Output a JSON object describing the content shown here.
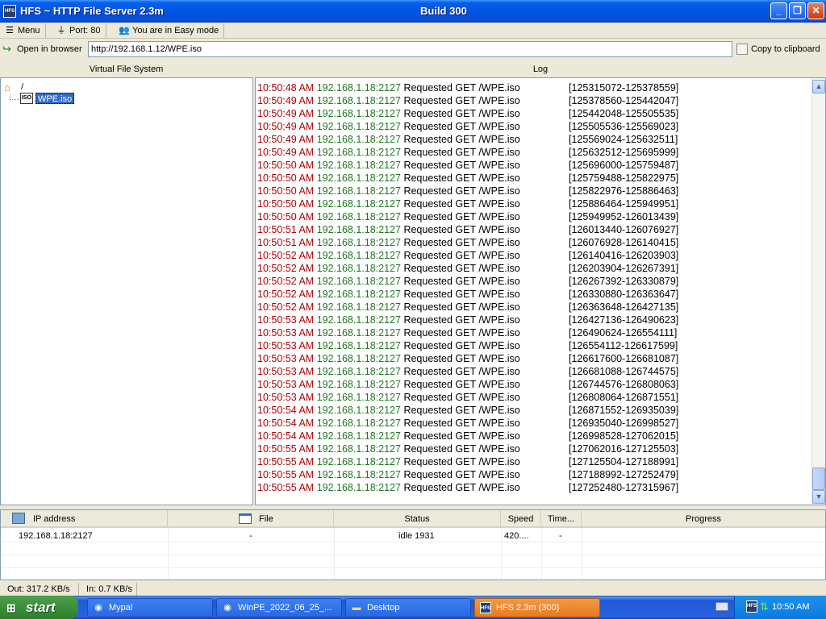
{
  "window": {
    "title": "HFS ~ HTTP File Server 2.3m",
    "build": "Build 300",
    "app_icon_text": "HFS"
  },
  "toolbar": {
    "menu_label": "Menu",
    "port_label": "Port: 80",
    "mode_label": "You are in Easy mode"
  },
  "address": {
    "open_label": "Open in browser",
    "url": "http://192.168.1.12/WPE.iso",
    "copy_label": "Copy to clipboard"
  },
  "vfs": {
    "header": "Virtual File System",
    "root_label": "/",
    "file_label": "WPE.iso",
    "file_icon_text": "ISO"
  },
  "log": {
    "header": "Log",
    "entries": [
      {
        "time": "10:50:48 AM",
        "ip": "192.168.1.18:2127",
        "msg": "Requested GET /WPE.iso",
        "range": "[125315072-125378559]"
      },
      {
        "time": "10:50:49 AM",
        "ip": "192.168.1.18:2127",
        "msg": "Requested GET /WPE.iso",
        "range": "[125378560-125442047]"
      },
      {
        "time": "10:50:49 AM",
        "ip": "192.168.1.18:2127",
        "msg": "Requested GET /WPE.iso",
        "range": "[125442048-125505535]"
      },
      {
        "time": "10:50:49 AM",
        "ip": "192.168.1.18:2127",
        "msg": "Requested GET /WPE.iso",
        "range": "[125505536-125569023]"
      },
      {
        "time": "10:50:49 AM",
        "ip": "192.168.1.18:2127",
        "msg": "Requested GET /WPE.iso",
        "range": "[125569024-125632511]"
      },
      {
        "time": "10:50:49 AM",
        "ip": "192.168.1.18:2127",
        "msg": "Requested GET /WPE.iso",
        "range": "[125632512-125695999]"
      },
      {
        "time": "10:50:50 AM",
        "ip": "192.168.1.18:2127",
        "msg": "Requested GET /WPE.iso",
        "range": "[125696000-125759487]"
      },
      {
        "time": "10:50:50 AM",
        "ip": "192.168.1.18:2127",
        "msg": "Requested GET /WPE.iso",
        "range": "[125759488-125822975]"
      },
      {
        "time": "10:50:50 AM",
        "ip": "192.168.1.18:2127",
        "msg": "Requested GET /WPE.iso",
        "range": "[125822976-125886463]"
      },
      {
        "time": "10:50:50 AM",
        "ip": "192.168.1.18:2127",
        "msg": "Requested GET /WPE.iso",
        "range": "[125886464-125949951]"
      },
      {
        "time": "10:50:50 AM",
        "ip": "192.168.1.18:2127",
        "msg": "Requested GET /WPE.iso",
        "range": "[125949952-126013439]"
      },
      {
        "time": "10:50:51 AM",
        "ip": "192.168.1.18:2127",
        "msg": "Requested GET /WPE.iso",
        "range": "[126013440-126076927]"
      },
      {
        "time": "10:50:51 AM",
        "ip": "192.168.1.18:2127",
        "msg": "Requested GET /WPE.iso",
        "range": "[126076928-126140415]"
      },
      {
        "time": "10:50:52 AM",
        "ip": "192.168.1.18:2127",
        "msg": "Requested GET /WPE.iso",
        "range": "[126140416-126203903]"
      },
      {
        "time": "10:50:52 AM",
        "ip": "192.168.1.18:2127",
        "msg": "Requested GET /WPE.iso",
        "range": "[126203904-126267391]"
      },
      {
        "time": "10:50:52 AM",
        "ip": "192.168.1.18:2127",
        "msg": "Requested GET /WPE.iso",
        "range": "[126267392-126330879]"
      },
      {
        "time": "10:50:52 AM",
        "ip": "192.168.1.18:2127",
        "msg": "Requested GET /WPE.iso",
        "range": "[126330880-126363647]"
      },
      {
        "time": "10:50:52 AM",
        "ip": "192.168.1.18:2127",
        "msg": "Requested GET /WPE.iso",
        "range": "[126363648-126427135]"
      },
      {
        "time": "10:50:53 AM",
        "ip": "192.168.1.18:2127",
        "msg": "Requested GET /WPE.iso",
        "range": "[126427136-126490623]"
      },
      {
        "time": "10:50:53 AM",
        "ip": "192.168.1.18:2127",
        "msg": "Requested GET /WPE.iso",
        "range": "[126490624-126554111]"
      },
      {
        "time": "10:50:53 AM",
        "ip": "192.168.1.18:2127",
        "msg": "Requested GET /WPE.iso",
        "range": "[126554112-126617599]"
      },
      {
        "time": "10:50:53 AM",
        "ip": "192.168.1.18:2127",
        "msg": "Requested GET /WPE.iso",
        "range": "[126617600-126681087]"
      },
      {
        "time": "10:50:53 AM",
        "ip": "192.168.1.18:2127",
        "msg": "Requested GET /WPE.iso",
        "range": "[126681088-126744575]"
      },
      {
        "time": "10:50:53 AM",
        "ip": "192.168.1.18:2127",
        "msg": "Requested GET /WPE.iso",
        "range": "[126744576-126808063]"
      },
      {
        "time": "10:50:53 AM",
        "ip": "192.168.1.18:2127",
        "msg": "Requested GET /WPE.iso",
        "range": "[126808064-126871551]"
      },
      {
        "time": "10:50:54 AM",
        "ip": "192.168.1.18:2127",
        "msg": "Requested GET /WPE.iso",
        "range": "[126871552-126935039]"
      },
      {
        "time": "10:50:54 AM",
        "ip": "192.168.1.18:2127",
        "msg": "Requested GET /WPE.iso",
        "range": "[126935040-126998527]"
      },
      {
        "time": "10:50:54 AM",
        "ip": "192.168.1.18:2127",
        "msg": "Requested GET /WPE.iso",
        "range": "[126998528-127062015]"
      },
      {
        "time": "10:50:55 AM",
        "ip": "192.168.1.18:2127",
        "msg": "Requested GET /WPE.iso",
        "range": "[127062016-127125503]"
      },
      {
        "time": "10:50:55 AM",
        "ip": "192.168.1.18:2127",
        "msg": "Requested GET /WPE.iso",
        "range": "[127125504-127188991]"
      },
      {
        "time": "10:50:55 AM",
        "ip": "192.168.1.18:2127",
        "msg": "Requested GET /WPE.iso",
        "range": "[127188992-127252479]"
      },
      {
        "time": "10:50:55 AM",
        "ip": "192.168.1.18:2127",
        "msg": "Requested GET /WPE.iso",
        "range": "[127252480-127315967]"
      }
    ]
  },
  "connections": {
    "columns": [
      "IP address",
      "File",
      "Status",
      "Speed",
      "Time...",
      "Progress"
    ],
    "rows": [
      {
        "ip": "192.168.1.18:2127",
        "file": "-",
        "status": "idle 1931",
        "speed": "420....",
        "time": "-",
        "progress": ""
      }
    ]
  },
  "statusbar": {
    "out": "Out: 317.2 KB/s",
    "in": "In: 0.7 KB/s"
  },
  "taskbar": {
    "start_label": "start",
    "tasks": [
      {
        "label": "Mypal",
        "icon": "browser-icon"
      },
      {
        "label": "WinPE_2022_06_25_...",
        "icon": "browser-icon"
      },
      {
        "label": "Desktop",
        "icon": "folder-icon"
      },
      {
        "label": "HFS 2.3m (300)",
        "icon": "hfs-icon",
        "active": true
      }
    ],
    "clock": "10:50 AM",
    "tray_hfs_text": "HFS"
  },
  "colors": {
    "log_time": "#b00000",
    "log_ip": "#207820",
    "selection": "#316AC5",
    "titlebar": "#0054E3"
  }
}
